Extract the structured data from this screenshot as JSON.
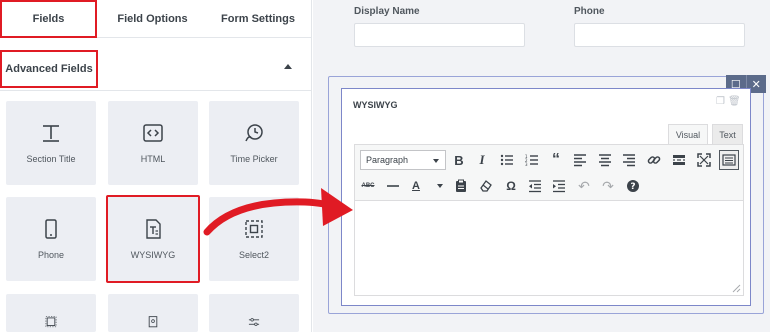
{
  "tabs": {
    "fields": "Fields",
    "field_options": "Field Options",
    "form_settings": "Form Settings"
  },
  "advanced_fields": {
    "label": "Advanced Fields"
  },
  "field_tiles": [
    {
      "label": "Section Title",
      "icon": "section-title-icon"
    },
    {
      "label": "HTML",
      "icon": "html-code-icon"
    },
    {
      "label": "Time Picker",
      "icon": "clock-icon"
    },
    {
      "label": "Phone",
      "icon": "phone-icon"
    },
    {
      "label": "WYSIWYG",
      "icon": "wysiwyg-icon",
      "selected": true
    },
    {
      "label": "Select2",
      "icon": "select2-icon"
    }
  ],
  "form": {
    "display_name_label": "Display Name",
    "phone_label": "Phone",
    "wysiwyg_title": "WYSIWYG"
  },
  "editor": {
    "visual_tab": "Visual",
    "text_tab": "Text",
    "format_select": "Paragraph"
  },
  "colors": {
    "highlight": "#e01b24",
    "arrow": "#e01b24",
    "selected_border": "#7d87c9"
  }
}
